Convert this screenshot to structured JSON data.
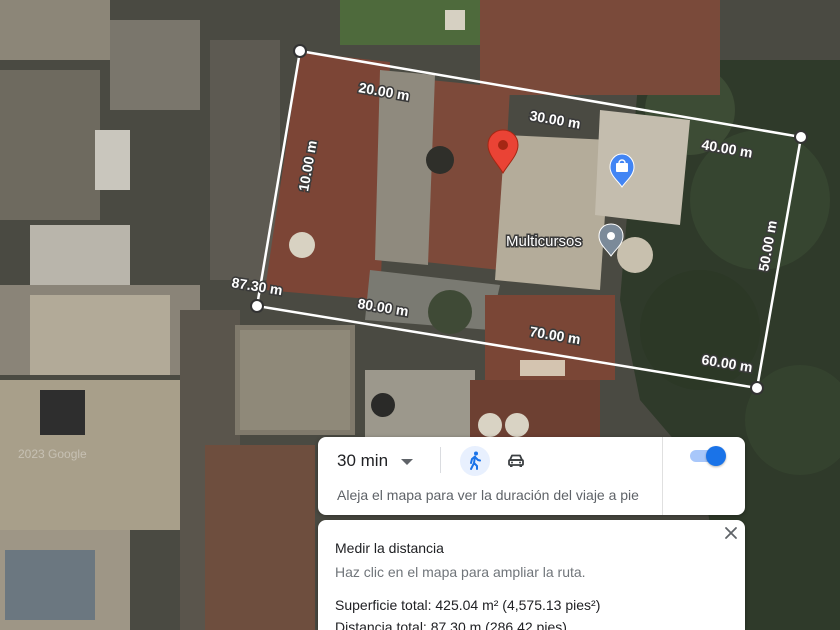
{
  "map": {
    "segment_labels": [
      "20.00 m",
      "30.00 m",
      "40.00 m",
      "10.00 m",
      "50.00 m",
      "87.30 m",
      "80.00 m",
      "70.00 m",
      "60.00 m"
    ],
    "poi_label": "Multicursos",
    "icons": [
      "location-pin-icon",
      "shopping-bag-icon",
      "place-marker-icon",
      "close-icon",
      "walking-icon",
      "car-icon"
    ],
    "colors": {
      "pin_red": "#ea4335",
      "poi_blue": "#4285f4",
      "poi_gray": "#7b8a99",
      "accent": "#1a73e8"
    }
  },
  "travel": {
    "duration": "30 min",
    "hint": "Aleja el mapa para ver la duración del viaje a pie",
    "selected_mode": "walking",
    "toggle_on": true
  },
  "measure": {
    "title": "Medir la distancia",
    "subtitle": "Haz clic en el mapa para ampliar la ruta.",
    "area": "Superficie total: 425.04 m² (4,575.13 pies²)",
    "distance": "Distancia total: 87.30 m (286.42 pies)"
  }
}
